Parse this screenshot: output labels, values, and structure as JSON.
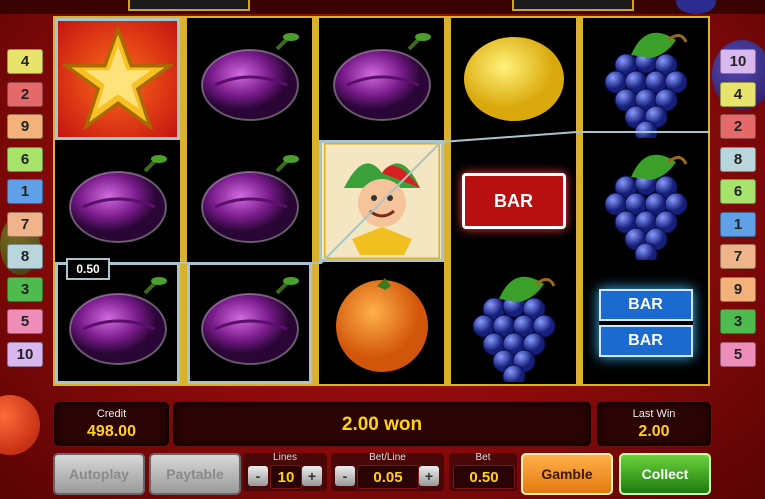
{
  "line_numbers_left": [
    "4",
    "2",
    "9",
    "6",
    "1",
    "7",
    "8",
    "3",
    "5",
    "10"
  ],
  "line_numbers_right": [
    "10",
    "4",
    "2",
    "8",
    "6",
    "1",
    "7",
    "9",
    "3",
    "5"
  ],
  "line_colors": {
    "1": "#5fa0e6",
    "2": "#e46a6a",
    "3": "#4dbb4d",
    "4": "#e8e36a",
    "5": "#ef8db9",
    "6": "#a6e36a",
    "7": "#f0b48a",
    "8": "#b9d6dd",
    "9": "#f2b27a",
    "10": "#d9b8f0"
  },
  "reels": [
    [
      "star",
      "plum",
      "plum"
    ],
    [
      "plum",
      "plum",
      "plum"
    ],
    [
      "plum",
      "joker",
      "orange"
    ],
    [
      "lemon",
      "bar-red",
      "grapes"
    ],
    [
      "grapes",
      "grapes",
      "bar-double"
    ]
  ],
  "win_line_value": "0.50",
  "info": {
    "credit_label": "Credit",
    "credit_value": "498.00",
    "message": "2.00 won",
    "last_win_label": "Last Win",
    "last_win_value": "2.00"
  },
  "controls": {
    "autoplay_label": "Autoplay",
    "paytable_label": "Paytable",
    "lines_label": "Lines",
    "lines_value": "10",
    "bet_line_label": "Bet/Line",
    "bet_line_value": "0.05",
    "bet_label": "Bet",
    "bet_value": "0.50",
    "gamble_label": "Gamble",
    "collect_label": "Collect",
    "minus": "-",
    "plus": "+"
  },
  "symbols": {
    "bar_text": "BAR"
  }
}
